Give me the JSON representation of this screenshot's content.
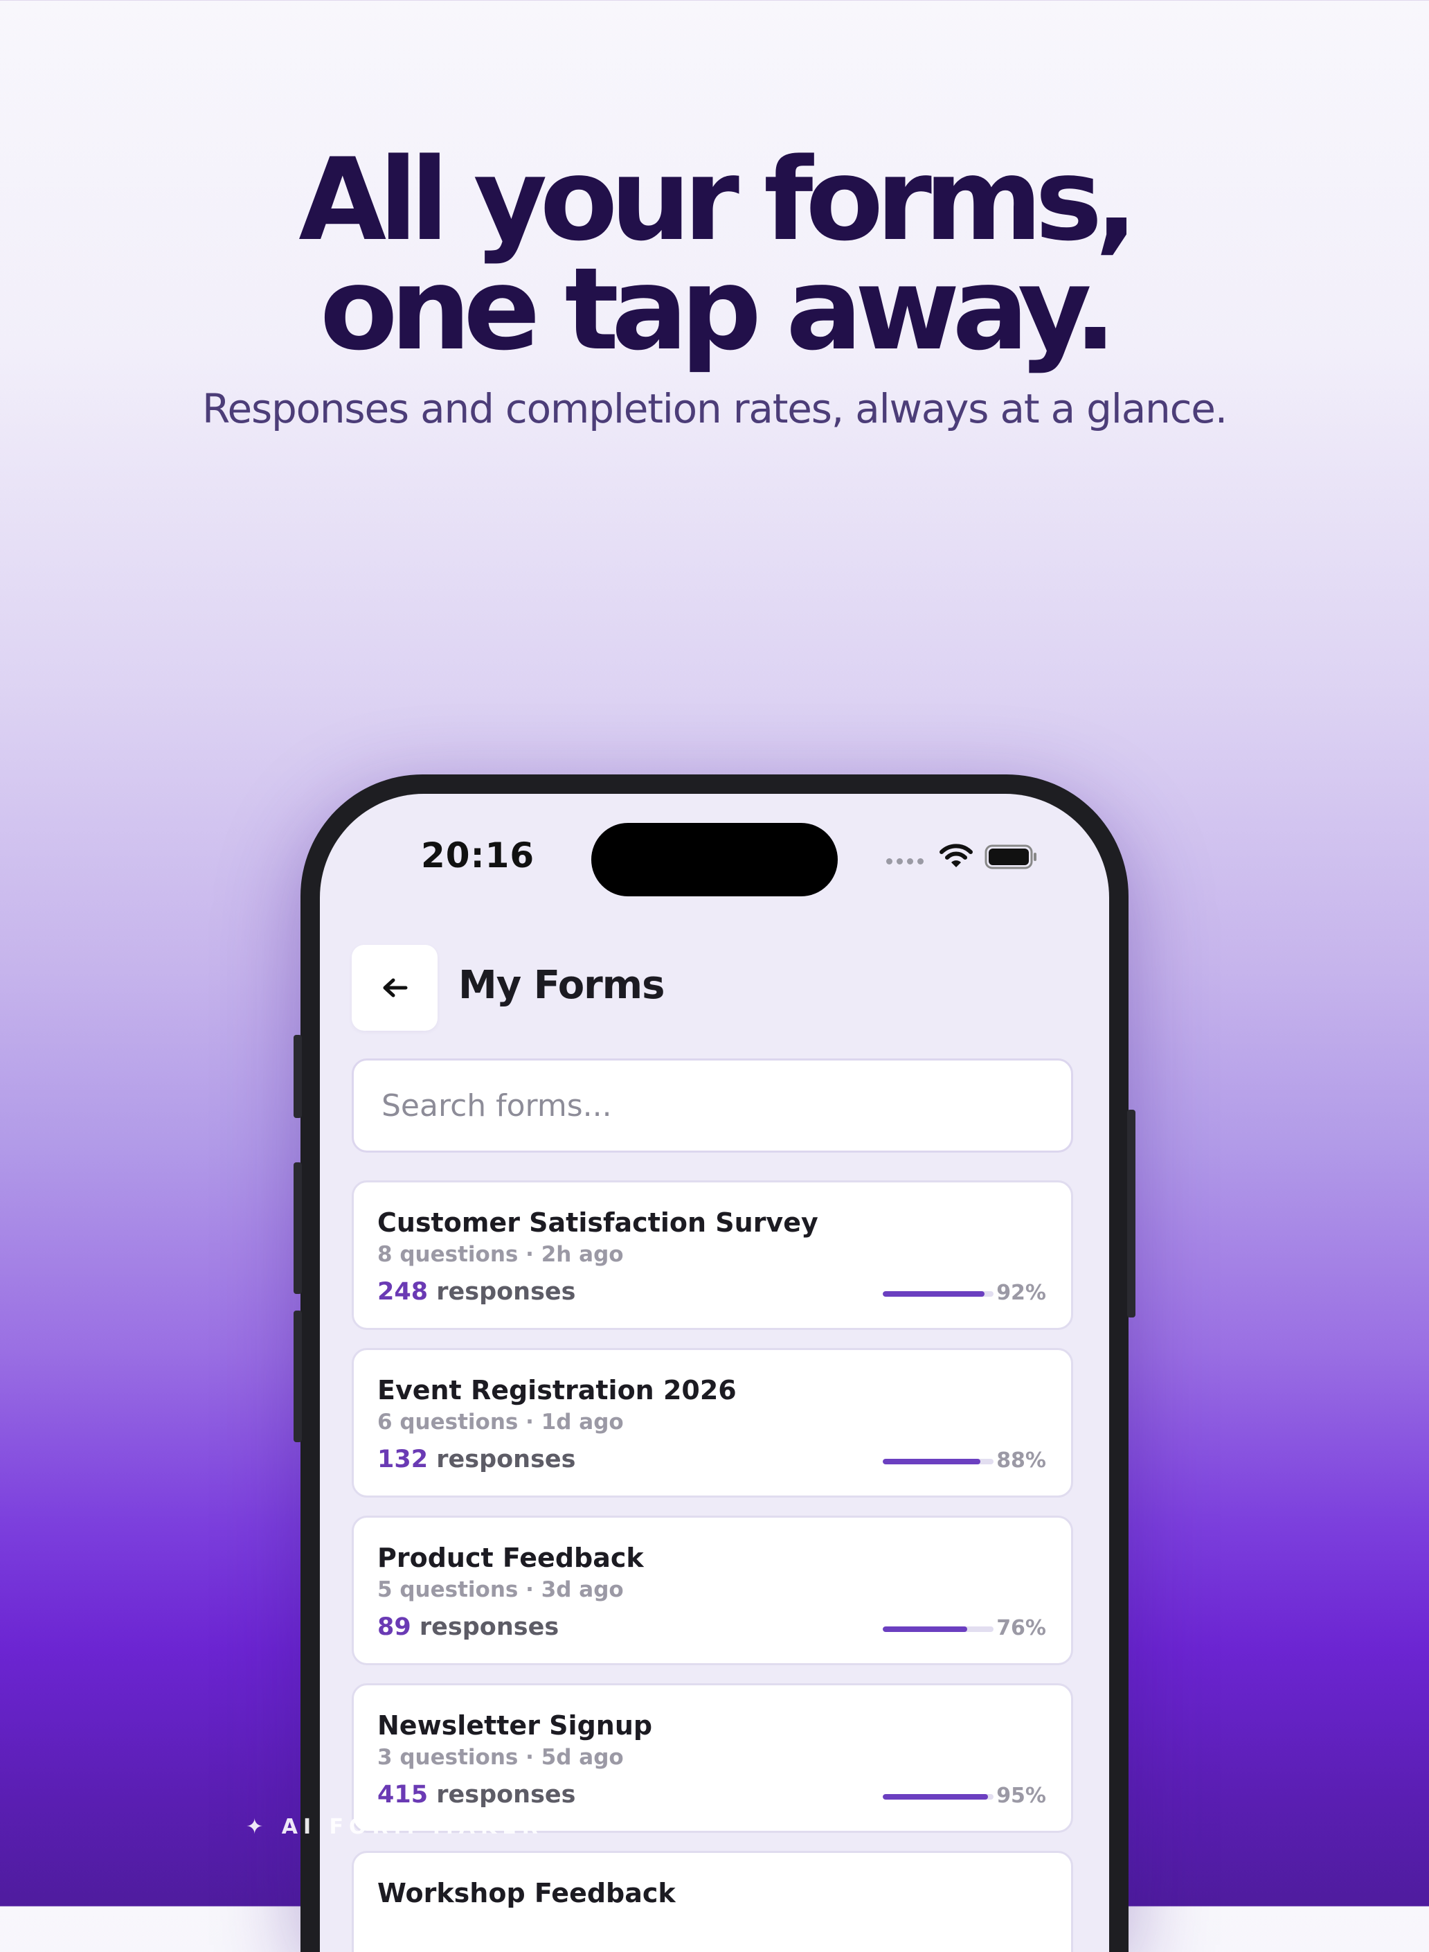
{
  "hero": {
    "headline_line1": "All your forms,",
    "headline_line2": "one tap away.",
    "subheadline": "Responses and completion rates, always at a glance."
  },
  "status_bar": {
    "time": "20:16"
  },
  "header": {
    "back_icon": "arrow-left-icon",
    "title": "My Forms"
  },
  "search": {
    "placeholder": "Search forms..."
  },
  "forms": [
    {
      "title": "Customer Satisfaction Survey",
      "meta": "8 questions · 2h ago",
      "responses": "248",
      "responses_label": "responses",
      "completion_pct": 92,
      "completion_label": "92%"
    },
    {
      "title": "Event Registration 2026",
      "meta": "6 questions · 1d ago",
      "responses": "132",
      "responses_label": "responses",
      "completion_pct": 88,
      "completion_label": "88%"
    },
    {
      "title": "Product Feedback",
      "meta": "5 questions · 3d ago",
      "responses": "89",
      "responses_label": "responses",
      "completion_pct": 76,
      "completion_label": "76%"
    },
    {
      "title": "Newsletter Signup",
      "meta": "3 questions · 5d ago",
      "responses": "415",
      "responses_label": "responses",
      "completion_pct": 95,
      "completion_label": "95%"
    },
    {
      "title": "Workshop Feedback",
      "meta": "",
      "responses": "",
      "responses_label": "",
      "completion_pct": null,
      "completion_label": ""
    }
  ],
  "watermark": "✦ AI FORM MAKER",
  "colors": {
    "accent": "#6b3fc0",
    "headline": "#22104a",
    "screen_bg": "#eeebf8"
  }
}
